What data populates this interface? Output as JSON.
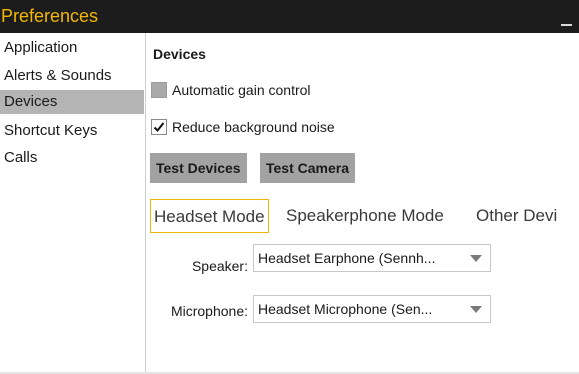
{
  "window": {
    "title": "Preferences"
  },
  "sidebar": {
    "items": [
      {
        "label": "Application"
      },
      {
        "label": "Alerts & Sounds"
      },
      {
        "label": "Devices"
      },
      {
        "label": "Shortcut Keys"
      },
      {
        "label": "Calls"
      }
    ],
    "selected": "Devices"
  },
  "devices": {
    "heading": "Devices",
    "agc": {
      "label": "Automatic gain control",
      "checked": false
    },
    "noise": {
      "label": "Reduce background noise",
      "checked": true
    },
    "test_devices_label": "Test Devices",
    "test_camera_label": "Test Camera",
    "tabs": [
      {
        "label": "Headset Mode"
      },
      {
        "label": "Speakerphone Mode"
      },
      {
        "label": "Other Devi"
      }
    ],
    "active_tab": "Headset Mode",
    "speaker": {
      "label": "Speaker:",
      "value": "Headset Earphone (Sennh..."
    },
    "microphone": {
      "label": "Microphone:",
      "value": "Headset Microphone (Sen..."
    }
  },
  "colors": {
    "accent": "#f2b705",
    "titlebar": "#1c1c1c",
    "selection": "#b4b4b4",
    "button": "#a2a2a2"
  },
  "icons": {
    "minimize": "minimize-icon",
    "checkmark": "checkmark-icon",
    "dropdown": "chevron-down-icon"
  }
}
